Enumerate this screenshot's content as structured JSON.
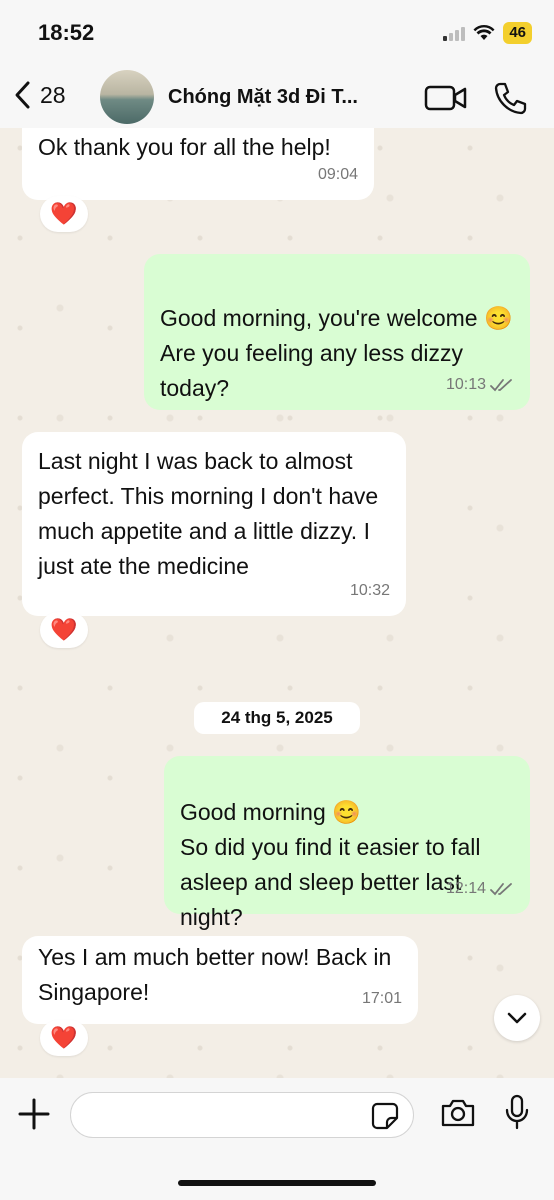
{
  "status_bar": {
    "time": "18:52",
    "battery": "46"
  },
  "header": {
    "back_count": "28",
    "title": "Chóng Mặt 3d Đi T..."
  },
  "messages": [
    {
      "text": "Ok thank you for all the help!",
      "time": "09:04",
      "reaction": "❤️"
    },
    {
      "text": "Good morning, you're welcome 😊\nAre you feeling any less dizzy today?",
      "time": "10:13"
    },
    {
      "text": "Last night I was back to almost perfect. This morning I don't have much appetite and a little dizzy. I just ate the medicine",
      "time": "10:32",
      "reaction": "❤️"
    },
    {
      "text": "Good morning 😊\nSo did you find it easier to fall asleep and sleep better last night?",
      "time": "12:14"
    },
    {
      "text": "Yes I am much better now! Back in Singapore!",
      "time": "17:01",
      "reaction": "❤️"
    }
  ],
  "date_separator": "24 thg 5, 2025",
  "colors": {
    "outgoing_bubble": "#d9fdd3",
    "incoming_bubble": "#ffffff",
    "battery": "#f3cf2d"
  }
}
